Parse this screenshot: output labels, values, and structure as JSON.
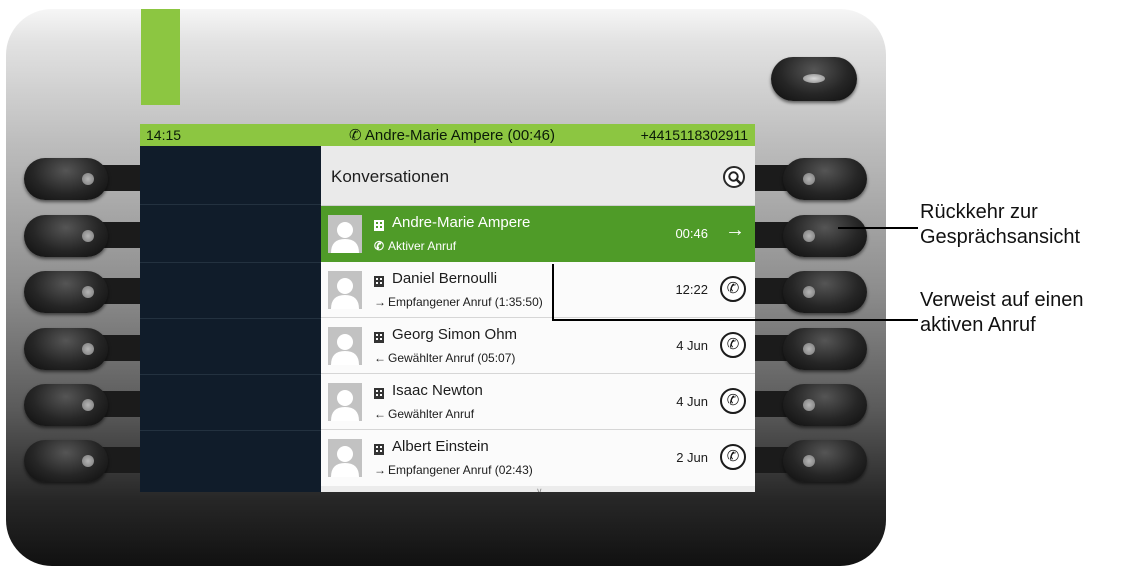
{
  "status_bar": {
    "time": "14:15",
    "active_call": "Andre-Marie Ampere (00:46)",
    "phone_number": "+4415118302911"
  },
  "screen": {
    "title": "Konversationen",
    "search_icon": "search-icon",
    "conversations": [
      {
        "name": "Andre-Marie Ampere",
        "detail": "Aktiver Anruf",
        "time": "00:46",
        "action_icon": "arrow-right-icon",
        "active": true
      },
      {
        "name": "Daniel Bernoulli",
        "detail": "Empfangener Anruf (1:35:50)",
        "time": "12:22",
        "action_icon": "phone-icon"
      },
      {
        "name": "Georg Simon Ohm",
        "detail": "Gewählter Anruf (05:07)",
        "time": "4 Jun",
        "action_icon": "phone-icon"
      },
      {
        "name": "Isaac Newton",
        "detail": "Gewählter Anruf",
        "time": "4 Jun",
        "action_icon": "phone-icon"
      },
      {
        "name": "Albert Einstein",
        "detail": "Empfangener Anruf (02:43)",
        "time": "2 Jun",
        "action_icon": "phone-icon"
      }
    ]
  },
  "annotations": {
    "return_line1": "Rückkehr zur",
    "return_line2": "Gesprächsansicht",
    "active_line1": "Verweist auf einen",
    "active_line2": "aktiven Anruf"
  },
  "colors": {
    "accent_green": "#8cc641",
    "active_row": "#4f9b28",
    "screen_dark": "#0f1b29"
  }
}
